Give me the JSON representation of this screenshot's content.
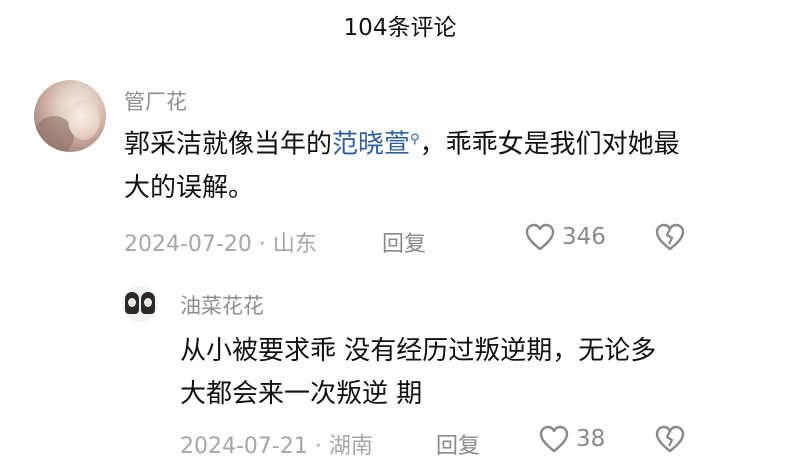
{
  "header": {
    "title": "104条评论"
  },
  "comments": [
    {
      "username": "管厂花",
      "text_before": "郭采洁就像当年的",
      "highlight": "范晓萱",
      "text_after": "，乖乖女是我们对她最大的误解。",
      "date_location": "2024-07-20 · 山东",
      "reply_label": "回复",
      "likes": "346"
    }
  ],
  "replies": [
    {
      "username": "油菜花花",
      "text": "从小被要求乖 没有经历过叛逆期，无论多大都会来一次叛逆 期",
      "date_location": "2024-07-21 · 湖南",
      "reply_label": "回复",
      "likes": "38"
    }
  ],
  "icons": {
    "search": "search-icon",
    "like": "heart-icon",
    "dislike": "broken-heart-icon"
  }
}
